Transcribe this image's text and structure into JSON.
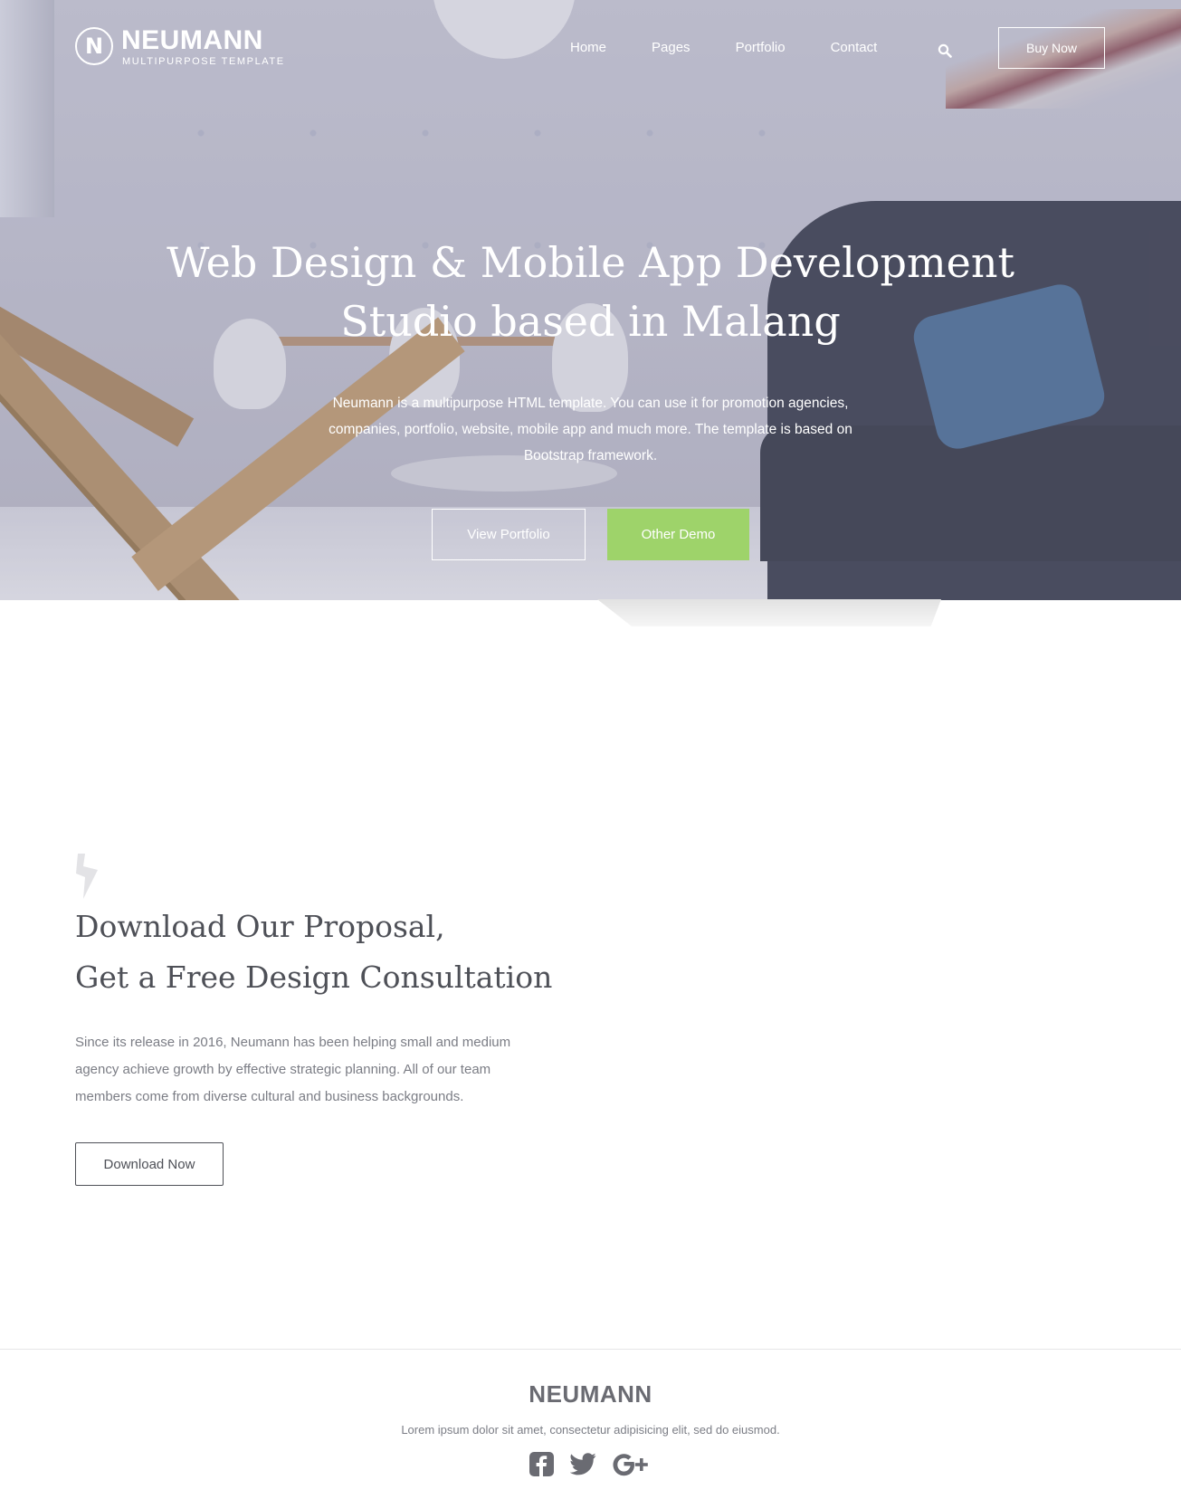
{
  "brand": {
    "name": "NEUMANN",
    "tagline": "MULTIPURPOSE TEMPLATE",
    "mark": "N"
  },
  "nav": {
    "items": [
      {
        "label": "Home"
      },
      {
        "label": "Pages"
      },
      {
        "label": "Portfolio"
      },
      {
        "label": "Contact"
      }
    ],
    "search_icon": "search-icon",
    "buy_label": "Buy Now"
  },
  "hero": {
    "title_line1": "Web Design & Mobile App Development",
    "title_line2": "Studio based in Malang",
    "description": "Neumann is a multipurpose HTML template. You can use it for promotion agencies, companies, portfolio, website, mobile app and much more. The template is based on Bootstrap framework.",
    "primary_button": "View Portfolio",
    "secondary_button": "Other Demo",
    "accent_color": "#9ed36a"
  },
  "proposal": {
    "icon": "lightning-bolt-icon",
    "title_line1": "Download Our Proposal,",
    "title_line2": "Get a Free Design Consultation",
    "text": "Since its release in 2016, Neumann has been helping small and medium agency achieve growth by effective strategic planning. All of our team members come from diverse cultural and business backgrounds.",
    "button": "Download Now"
  },
  "footer": {
    "brand": "NEUMANN",
    "text": "Lorem ipsum dolor sit amet, consectetur adipisicing elit, sed do eiusmod.",
    "social": [
      "facebook-icon",
      "twitter-icon",
      "google-plus-icon"
    ]
  }
}
